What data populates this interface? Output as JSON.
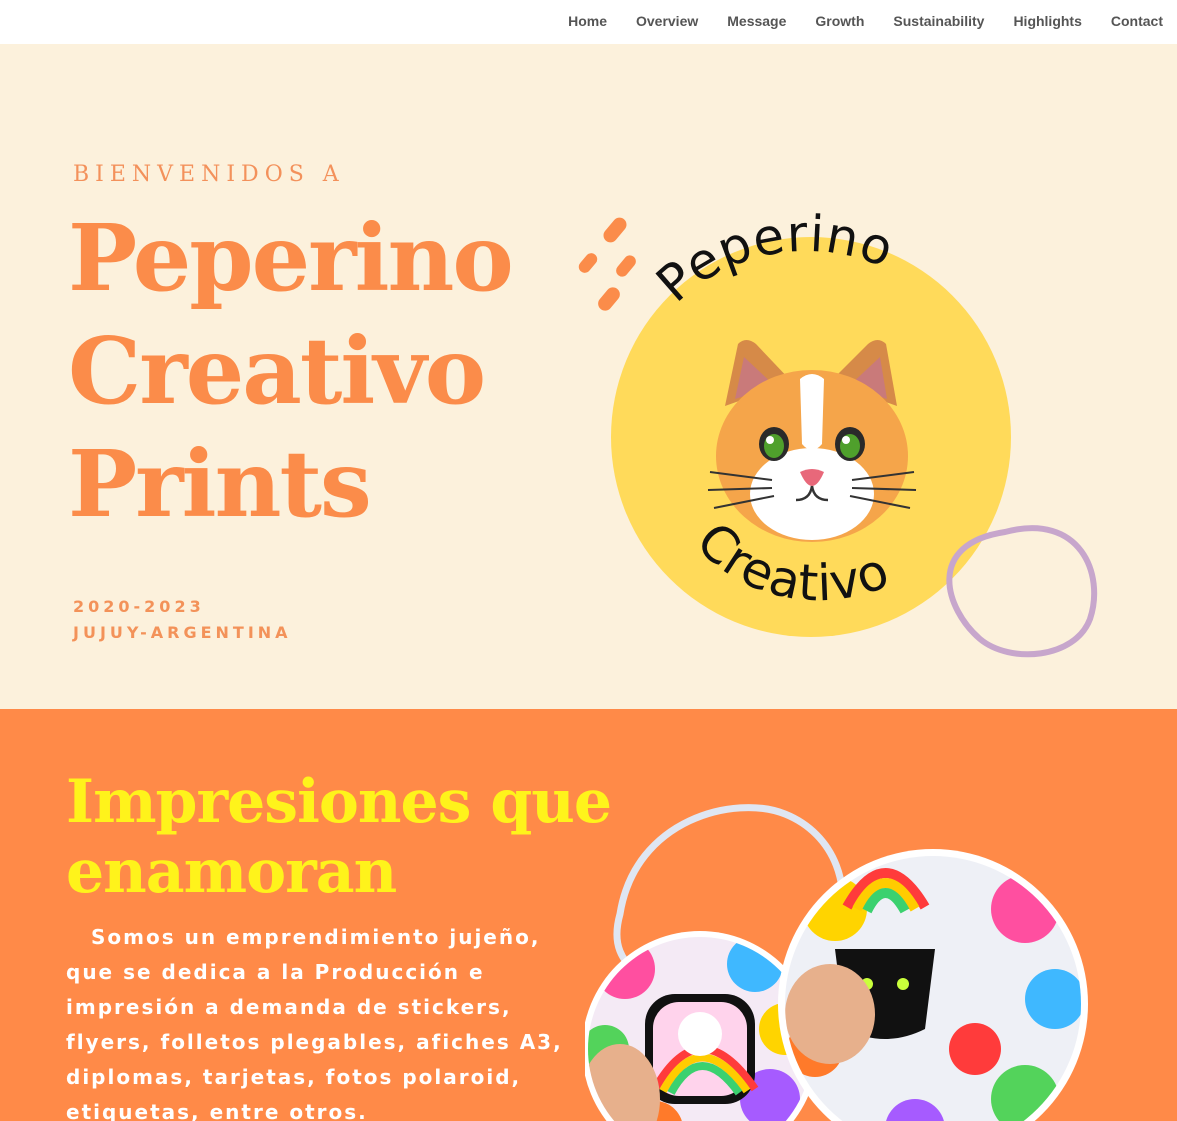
{
  "nav": {
    "items": [
      "Home",
      "Overview",
      "Message",
      "Growth",
      "Sustainability",
      "Highlights",
      "Contact"
    ]
  },
  "hero": {
    "kicker": "BIENVENIDOS A",
    "title_lines": [
      "Peperino",
      "Creativo",
      "Prints"
    ],
    "years": "2020-2023",
    "place": "JUJUY-ARGENTINA",
    "logo": {
      "top_text": "Peperino",
      "bottom_text": "Creativo",
      "icon": "cat-face-icon"
    }
  },
  "section2": {
    "title_lines": [
      "Impresiones que",
      "enamoran"
    ],
    "body": "Somos un emprendimiento jujeño, que se dedica a la Producción e impresión a demanda de stickers, flyers, folletos plegables, afiches A3, diplomas, tarjetas, fotos polaroid, etiquetas, entre otros."
  },
  "colors": {
    "hero_bg": "#fcf1dc",
    "accent_orange": "#fb8c4a",
    "section_orange": "#ff8a48",
    "title_yellow": "#fff31b",
    "logo_yellow": "#ffda5a",
    "ring_purple": "#c7a6cc",
    "ring_blue": "#dfe6f2"
  }
}
